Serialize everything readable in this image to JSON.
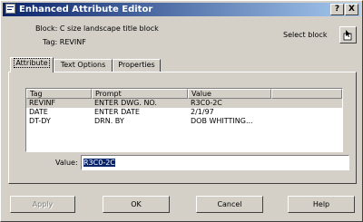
{
  "window": {
    "title": "Enhanced Attribute Editor",
    "help_button": "?",
    "close_button": "X"
  },
  "info": {
    "block_label": "Block: C size landscape title block",
    "tag_label": "Tag: REVINF",
    "select_block_label": "Select block"
  },
  "tabs": [
    {
      "label": "Attribute",
      "active": true
    },
    {
      "label": "Text Options",
      "active": false
    },
    {
      "label": "Properties",
      "active": false
    }
  ],
  "table": {
    "columns": [
      "Tag",
      "Prompt",
      "Value"
    ],
    "rows": [
      {
        "tag": "REVINF",
        "prompt": "ENTER DWG. NO.",
        "value": "R3C0-2C",
        "selected": true
      },
      {
        "tag": "DATE",
        "prompt": "ENTER DATE",
        "value": "2/1/97",
        "selected": false
      },
      {
        "tag": "DT-DY",
        "prompt": "DRN. BY",
        "value": "DOB WHITTING...",
        "selected": false
      }
    ]
  },
  "value_field": {
    "label": "Value:",
    "value": "R3C0-2C"
  },
  "buttons": {
    "apply": "Apply",
    "ok": "OK",
    "cancel": "Cancel",
    "help": "Help"
  },
  "colors": {
    "title_start": "#0a246a",
    "title_end": "#a6caf0",
    "face": "#d4d0c8"
  }
}
